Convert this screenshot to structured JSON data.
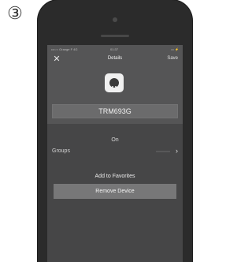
{
  "step_badge": "③",
  "statusbar": {
    "carrier": "•••○○ Orange F  4G",
    "time": "01:37",
    "battery": "▭ ⚡"
  },
  "navbar": {
    "close_icon": "close-icon",
    "title": "Details",
    "save_label": "Save"
  },
  "device": {
    "icon": "smart-plug-icon",
    "name": "TRM693G"
  },
  "state_label": "On",
  "groups": {
    "label": "Groups",
    "chevron": "›"
  },
  "favorites_label": "Add to Favorites",
  "remove_label": "Remove Device"
}
